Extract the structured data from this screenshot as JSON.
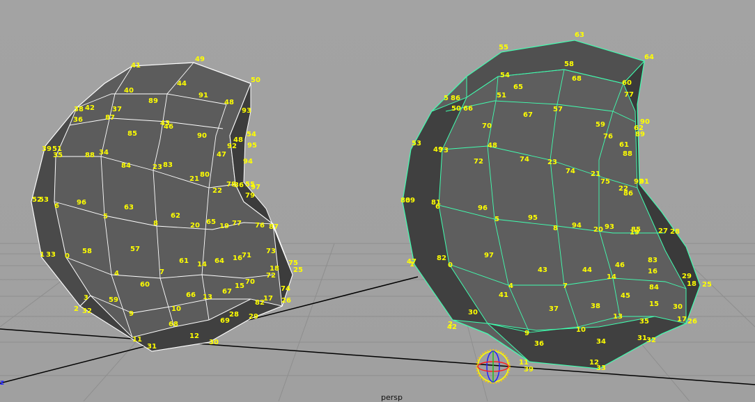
{
  "viewport": {
    "camera_name": "persp",
    "axis_indicator": "z",
    "colors": {
      "background": "#a0a0a0",
      "grid": "#8d8d8d",
      "axis_line": "#000000",
      "component_labels": "#ffff00",
      "left_wireframe": "#ffffff",
      "right_wireframe": "#40ffb0",
      "face_front": "#6a6a6a",
      "face_side": "#3a3a3a"
    }
  },
  "meshes": {
    "left": {
      "wireframe": "white",
      "labels": [
        "41",
        "49",
        "40",
        "44",
        "91",
        "50",
        "48",
        "93",
        "38",
        "42",
        "37",
        "89",
        "36",
        "87",
        "43",
        "46",
        "85",
        "90",
        "54",
        "48",
        "95",
        "39",
        "51",
        "35",
        "88",
        "34",
        "47",
        "92",
        "84",
        "23",
        "83",
        "94",
        "21",
        "80",
        "78",
        "36",
        "55",
        "97",
        "52",
        "53",
        "6",
        "96",
        "63",
        "22",
        "79",
        "5",
        "62",
        "20",
        "65",
        "19",
        "77",
        "76",
        "87",
        "8",
        "1",
        "33",
        "58",
        "57",
        "0",
        "71",
        "16",
        "73",
        "61",
        "64",
        "14",
        "4",
        "7",
        "18",
        "25",
        "60",
        "72",
        "75",
        "15",
        "70",
        "67",
        "74",
        "3",
        "59",
        "66",
        "13",
        "82",
        "17",
        "26",
        "2",
        "32",
        "10",
        "9",
        "28",
        "69",
        "29",
        "68",
        "11",
        "12",
        "30",
        "31"
      ]
    },
    "right": {
      "wireframe": "green",
      "labels": [
        "63",
        "55",
        "64",
        "58",
        "54",
        "60",
        "68",
        "65",
        "77",
        "5",
        "86",
        "51",
        "50",
        "66",
        "57",
        "67",
        "70",
        "59",
        "62",
        "90",
        "89",
        "76",
        "73",
        "48",
        "61",
        "88",
        "49",
        "53",
        "74",
        "72",
        "23",
        "74",
        "21",
        "75",
        "92",
        "91",
        "22",
        "86",
        "80",
        "89",
        "81",
        "6",
        "96",
        "5",
        "95",
        "8",
        "94",
        "20",
        "93",
        "85",
        "19",
        "27",
        "28",
        "82",
        "97",
        "83",
        "0",
        "47",
        "1",
        "43",
        "44",
        "16",
        "46",
        "4",
        "41",
        "14",
        "84",
        "7",
        "29",
        "18",
        "25",
        "45",
        "37",
        "38",
        "15",
        "30",
        "35",
        "2",
        "42",
        "30",
        "9",
        "10",
        "13",
        "17",
        "26",
        "34",
        "31",
        "32",
        "36",
        "11",
        "39",
        "12",
        "33"
      ]
    }
  }
}
